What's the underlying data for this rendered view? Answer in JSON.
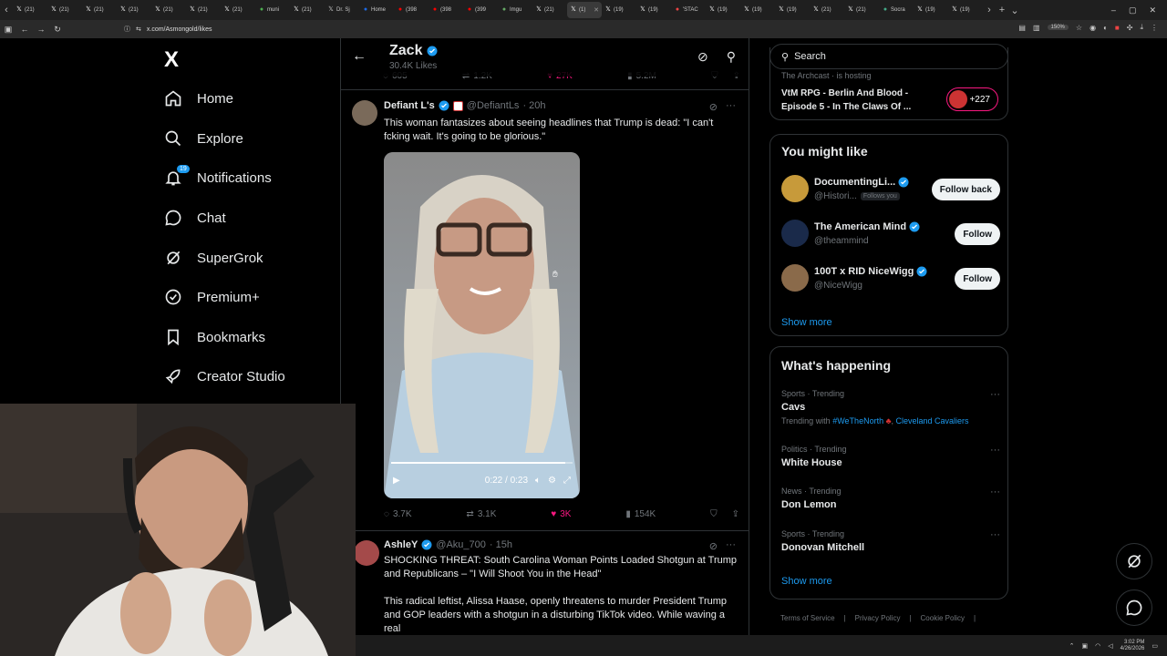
{
  "browser": {
    "tabs": [
      {
        "label": "(21)",
        "active": false
      },
      {
        "label": "(21)",
        "active": false
      },
      {
        "label": "(21)",
        "active": false
      },
      {
        "label": "(21)",
        "active": false
      },
      {
        "label": "(21)",
        "active": false
      },
      {
        "label": "(21)",
        "active": false
      },
      {
        "label": "(21)",
        "active": false
      },
      {
        "label": "muni",
        "active": false
      },
      {
        "label": "(21)",
        "active": false
      },
      {
        "label": "Dr. Sj",
        "active": false
      },
      {
        "label": "Home",
        "active": false
      },
      {
        "label": "(398",
        "active": false
      },
      {
        "label": "(398",
        "active": false
      },
      {
        "label": "(399",
        "active": false
      },
      {
        "label": "Imgu",
        "active": false
      },
      {
        "label": "(21)",
        "active": false
      },
      {
        "label": "(1)",
        "active": true
      },
      {
        "label": "(19)",
        "active": false
      },
      {
        "label": "(19)",
        "active": false
      },
      {
        "label": "'STAC",
        "active": false
      },
      {
        "label": "(19)",
        "active": false
      },
      {
        "label": "(19)",
        "active": false
      },
      {
        "label": "(19)",
        "active": false
      },
      {
        "label": "(21)",
        "active": false
      },
      {
        "label": "(21)",
        "active": false
      },
      {
        "label": "Socra",
        "active": false
      },
      {
        "label": "(19)",
        "active": false
      },
      {
        "label": "(19)",
        "active": false
      }
    ],
    "url": "x.com/Asmongold/likes",
    "zoom": "150%"
  },
  "leftnav": {
    "logo": "X",
    "items": [
      {
        "label": "Home",
        "icon": "home-icon"
      },
      {
        "label": "Explore",
        "icon": "search-icon"
      },
      {
        "label": "Notifications",
        "icon": "bell-icon",
        "badge": "19"
      },
      {
        "label": "Chat",
        "icon": "chat-icon"
      },
      {
        "label": "SuperGrok",
        "icon": "grok-icon"
      },
      {
        "label": "Premium+",
        "icon": "premium-icon"
      },
      {
        "label": "Bookmarks",
        "icon": "bookmark-icon"
      },
      {
        "label": "Creator Studio",
        "icon": "rocket-icon"
      }
    ]
  },
  "header": {
    "title": "Zack",
    "subtitle": "30.4K Likes"
  },
  "prev_tweet_actions": {
    "replies": "605",
    "reposts": "1.2K",
    "likes": "27K",
    "views": "5.2M"
  },
  "tweets": [
    {
      "name": "Defiant L's",
      "handle": "@DefiantLs",
      "time": "· 20h",
      "text": "This woman fantasizes about seeing headlines that Trump is dead: \"I can't fcking wait. It's going to be glorious.\"",
      "video": {
        "time": "0:22 / 0:23",
        "progress": 0.96
      },
      "replies": "3.7K",
      "reposts": "3.1K",
      "likes": "3K",
      "views": "154K"
    },
    {
      "name": "AshleY",
      "handle": "@Aku_700",
      "time": "· 15h",
      "text": "SHOCKING THREAT: South Carolina Woman Points Loaded Shotgun at Trump and Republicans – \"I Will Shoot You in the Head\"",
      "text2": "This radical leftist, Alissa Haase, openly threatens to murder President Trump and GOP leaders with a shotgun in a disturbing TikTok video. While waving a real"
    }
  ],
  "right": {
    "search_placeholder": "Search",
    "space": {
      "host": "The Archcast · is hosting",
      "title": "VtM RPG - Berlin And Blood - Episode 5 - In The Claws Of ...",
      "count": "+227"
    },
    "you_might_like": {
      "title": "You might like",
      "people": [
        {
          "name": "DocumentingLi...",
          "handle": "@Histori...",
          "follows_you": "Follows you",
          "button": "Follow back",
          "color": "#c79a3a"
        },
        {
          "name": "The American Mind",
          "handle": "@theammind",
          "button": "Follow",
          "color": "#1a2a4a"
        },
        {
          "name": "100T x RID NiceWigg",
          "handle": "@NiceWigg",
          "button": "Follow",
          "color": "#8a6a4a"
        }
      ],
      "show_more": "Show more"
    },
    "happening": {
      "title": "What's happening",
      "trends": [
        {
          "category": "Sports · Trending",
          "name": "Cavs",
          "with_label": "Trending with",
          "with_links": [
            "#WeTheNorth",
            "Cleveland Cavaliers"
          ]
        },
        {
          "category": "Politics · Trending",
          "name": "White House"
        },
        {
          "category": "News · Trending",
          "name": "Don Lemon"
        },
        {
          "category": "Sports · Trending",
          "name": "Donovan Mitchell"
        }
      ],
      "show_more": "Show more"
    },
    "footer": [
      "Terms of Service",
      "|",
      "Privacy Policy",
      "|",
      "Cookie Policy",
      "|"
    ]
  },
  "taskbar": {
    "time": "3:02 PM",
    "date": "4/26/2026"
  },
  "colors": {
    "accent": "#1d9bf0",
    "like": "#f91880",
    "text": "#e7e9ea",
    "muted": "#71767b",
    "border": "#2f3336"
  }
}
